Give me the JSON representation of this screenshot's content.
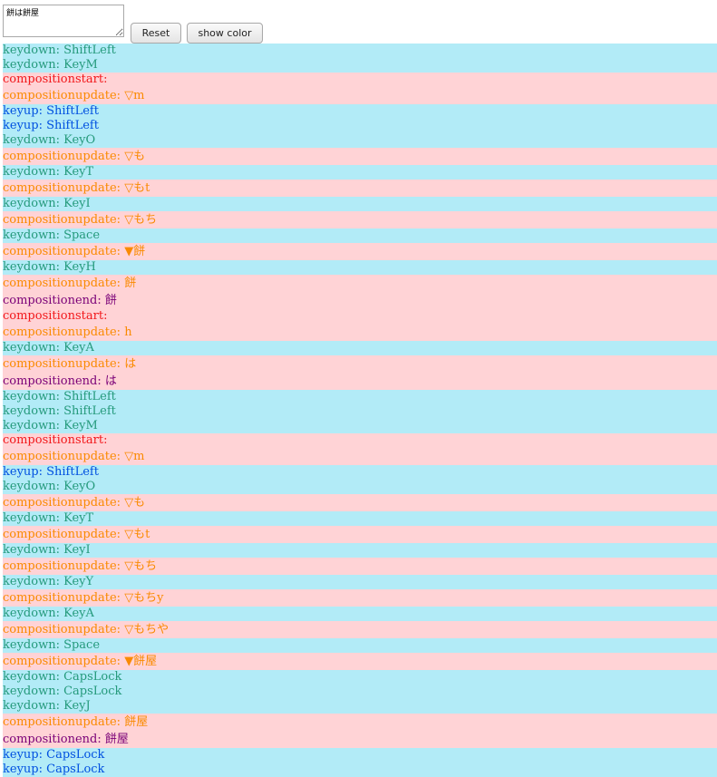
{
  "editor": {
    "value": "餅は餅屋"
  },
  "toolbar": {
    "reset_label": "Reset",
    "show_color_label": "show color"
  },
  "colors": {
    "key_row_bg": "#b2ebf7",
    "composition_row_bg": "#ffd3d6",
    "keydown": "#259a7c",
    "keyup": "#0050e0",
    "compositionstart": "#f2181b",
    "compositionupdate": "#fa8a00",
    "compositionend": "#7a0077"
  },
  "log": [
    {
      "text": "keydown: ShiftLeft",
      "kind": "keydown"
    },
    {
      "text": "keydown: KeyM",
      "kind": "keydown"
    },
    {
      "text": "compositionstart:",
      "kind": "compositionstart"
    },
    {
      "text": "compositionupdate: ▽m",
      "kind": "compositionupdate"
    },
    {
      "text": "keyup: ShiftLeft",
      "kind": "keyup"
    },
    {
      "text": "keyup: ShiftLeft",
      "kind": "keyup"
    },
    {
      "text": "keydown: KeyO",
      "kind": "keydown"
    },
    {
      "text": "compositionupdate: ▽も",
      "kind": "compositionupdate"
    },
    {
      "text": "keydown: KeyT",
      "kind": "keydown"
    },
    {
      "text": "compositionupdate: ▽もt",
      "kind": "compositionupdate"
    },
    {
      "text": "keydown: KeyI",
      "kind": "keydown"
    },
    {
      "text": "compositionupdate: ▽もち",
      "kind": "compositionupdate"
    },
    {
      "text": "keydown: Space",
      "kind": "keydown"
    },
    {
      "text": "compositionupdate: ▼餅",
      "kind": "compositionupdate"
    },
    {
      "text": "keydown: KeyH",
      "kind": "keydown"
    },
    {
      "text": "compositionupdate: 餅",
      "kind": "compositionupdate"
    },
    {
      "text": "compositionend: 餅",
      "kind": "compositionend"
    },
    {
      "text": "compositionstart:",
      "kind": "compositionstart"
    },
    {
      "text": "compositionupdate: h",
      "kind": "compositionupdate"
    },
    {
      "text": "keydown: KeyA",
      "kind": "keydown"
    },
    {
      "text": "compositionupdate: は",
      "kind": "compositionupdate"
    },
    {
      "text": "compositionend: は",
      "kind": "compositionend"
    },
    {
      "text": "keydown: ShiftLeft",
      "kind": "keydown"
    },
    {
      "text": "keydown: ShiftLeft",
      "kind": "keydown"
    },
    {
      "text": "keydown: KeyM",
      "kind": "keydown"
    },
    {
      "text": "compositionstart:",
      "kind": "compositionstart"
    },
    {
      "text": "compositionupdate: ▽m",
      "kind": "compositionupdate"
    },
    {
      "text": "keyup: ShiftLeft",
      "kind": "keyup"
    },
    {
      "text": "keydown: KeyO",
      "kind": "keydown"
    },
    {
      "text": "compositionupdate: ▽も",
      "kind": "compositionupdate"
    },
    {
      "text": "keydown: KeyT",
      "kind": "keydown"
    },
    {
      "text": "compositionupdate: ▽もt",
      "kind": "compositionupdate"
    },
    {
      "text": "keydown: KeyI",
      "kind": "keydown"
    },
    {
      "text": "compositionupdate: ▽もち",
      "kind": "compositionupdate"
    },
    {
      "text": "keydown: KeyY",
      "kind": "keydown"
    },
    {
      "text": "compositionupdate: ▽もちy",
      "kind": "compositionupdate"
    },
    {
      "text": "keydown: KeyA",
      "kind": "keydown"
    },
    {
      "text": "compositionupdate: ▽もちや",
      "kind": "compositionupdate"
    },
    {
      "text": "keydown: Space",
      "kind": "keydown"
    },
    {
      "text": "compositionupdate: ▼餅屋",
      "kind": "compositionupdate"
    },
    {
      "text": "keydown: CapsLock",
      "kind": "keydown"
    },
    {
      "text": "keydown: CapsLock",
      "kind": "keydown"
    },
    {
      "text": "keydown: KeyJ",
      "kind": "keydown"
    },
    {
      "text": "compositionupdate: 餅屋",
      "kind": "compositionupdate"
    },
    {
      "text": "compositionend: 餅屋",
      "kind": "compositionend"
    },
    {
      "text": "keyup: CapsLock",
      "kind": "keyup"
    },
    {
      "text": "keyup: CapsLock",
      "kind": "keyup"
    }
  ]
}
